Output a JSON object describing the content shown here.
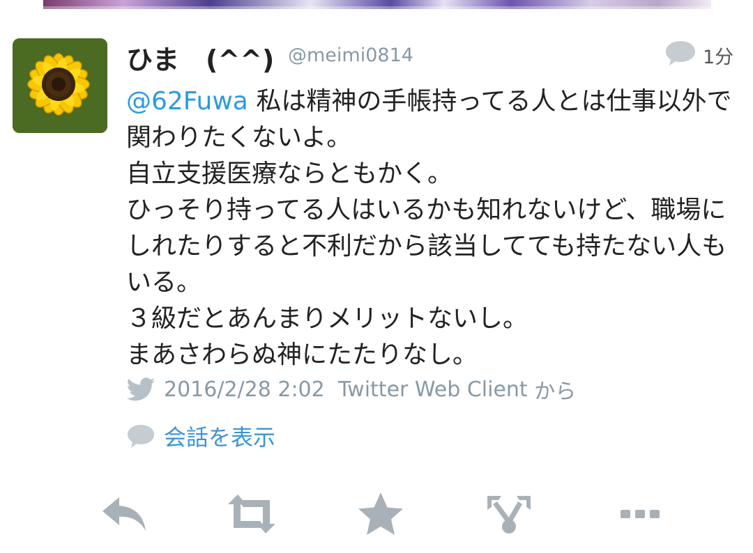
{
  "tweet": {
    "display_name": "ひま　(^^)",
    "handle": "@meimi0814",
    "time_ago": "1分",
    "mention": "@62Fuwa",
    "text_after_mention": " 私は精神の手帳持ってる人とは仕事以外で関わりたくないよ。\n自立支援医療ならともかく。\nひっそり持ってる人はいるかも知れないけど、職場にしれたりすると不利だから該当してても持たない人もいる。\n３級だとあんまりメリットないし。\nまあさわらぬ神にたたりなし。",
    "timestamp": "2016/2/28 2:02",
    "client": "Twitter Web Client",
    "client_suffix": "から",
    "view_conversation": "会話を表示"
  },
  "icons": {
    "avatar": "sunflower-avatar",
    "reply_count": "speech-bubble-icon",
    "source": "twitter-bird-icon",
    "conversation": "speech-bubble-icon",
    "actions": [
      "reply-icon",
      "retweet-icon",
      "favorite-star-icon",
      "share-icon",
      "more-icon"
    ]
  },
  "colors": {
    "link": "#2a9ae0",
    "meta_text": "#8899a6",
    "icon_gray": "#b8c0c7"
  }
}
